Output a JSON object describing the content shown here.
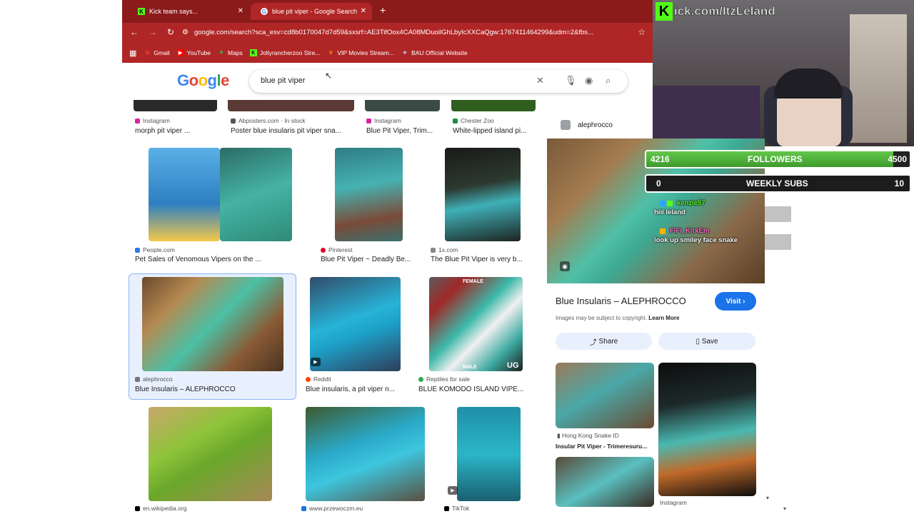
{
  "browser": {
    "tabs": [
      {
        "label": "Kick team says...",
        "fav": "K",
        "fav_color": "#53fc18",
        "active": false
      },
      {
        "label": "blue pit viper - Google Search",
        "fav": "G",
        "fav_color": "#ffffff",
        "active": true
      }
    ],
    "url": "google.com/search?sca_esv=cd8b0170047d7d59&sxsrf=AE3TifOox4CA08MDuoilGhLbyIcXXCaQgw:1767411464299&udm=2&fbs...",
    "bookmarks": [
      {
        "label": "Gmail",
        "color": "#ea4335",
        "glyph": "M"
      },
      {
        "label": "YouTube",
        "color": "#ff0000",
        "glyph": "▶"
      },
      {
        "label": "Maps",
        "color": "#34a853",
        "glyph": "⬥"
      },
      {
        "label": "Jollyrancherzoo Stre...",
        "color": "#53fc18",
        "glyph": "K"
      },
      {
        "label": "VIP Movies Stream...",
        "color": "#f5b400",
        "glyph": "V"
      },
      {
        "label": "BAU Official Website",
        "color": "#6a7bd8",
        "glyph": "✈"
      }
    ]
  },
  "google": {
    "logo": "Google",
    "query": "blue pit viper"
  },
  "results": {
    "top_row": [
      {
        "source": "Instagram",
        "title": "morph pit viper ..."
      },
      {
        "source": "Abposters.com · In stock",
        "title": "Poster blue insularis pit viper sna..."
      },
      {
        "source": "Instagram",
        "title": "Blue Pit Viper, Trim..."
      },
      {
        "source": "Chester Zoo",
        "title": "White-lipped island pi..."
      }
    ],
    "row2": [
      {
        "source": "People.com",
        "title": "Pet Sales of Venomous Vipers on the ..."
      },
      {
        "source": "Pinterest",
        "title": "Blue Pit Viper ~ Deadly Be..."
      },
      {
        "source": "1x.com",
        "title": "The Blue Pit Viper is very b..."
      }
    ],
    "row3": [
      {
        "source": "alephrocco",
        "title": "Blue Insularis – ALEPHROCCO"
      },
      {
        "source": "Reddit",
        "title": "Blue insularis, a pit viper n..."
      },
      {
        "source": "Reptiles for sale",
        "title": "BLUE KOMODO ISLAND VIPE..."
      }
    ],
    "row3_labels": {
      "female": "FEMALE",
      "male": "MALE",
      "ug": "UG"
    },
    "row4": [
      {
        "source": "en.wikipedia.org"
      },
      {
        "source": "www.przewoczm.eu"
      },
      {
        "source": "TikTok"
      }
    ]
  },
  "panel": {
    "source": "alephrocco",
    "title": "Blue Insularis – ALEPHROCCO",
    "visit": "Visit",
    "copyright": "Images may be subject to copyright.",
    "learn_more": "Learn More",
    "share": "Share",
    "save": "Save",
    "related": [
      {
        "source": "Hong Kong Snake ID",
        "title": "Insular Pit Viper - Trimeresuru..."
      },
      {
        "source": "Instagram"
      }
    ]
  },
  "stream": {
    "kick_url": "ick.com/ItzLeland",
    "followers_current": "4216",
    "followers_label": "FOLLOWERS",
    "followers_goal": "4500",
    "followers_progress": 0.937,
    "subs_current": "0",
    "subs_label": "WEEKLY SUBS",
    "subs_goal": "10",
    "chat": [
      {
        "user": "kenzie57",
        "user_color": "#53fc18",
        "message": "hiii leland"
      },
      {
        "user": "FiFi_KirkEm",
        "user_color": "#ff6ec7",
        "message": "look up smiley face snake"
      }
    ]
  }
}
